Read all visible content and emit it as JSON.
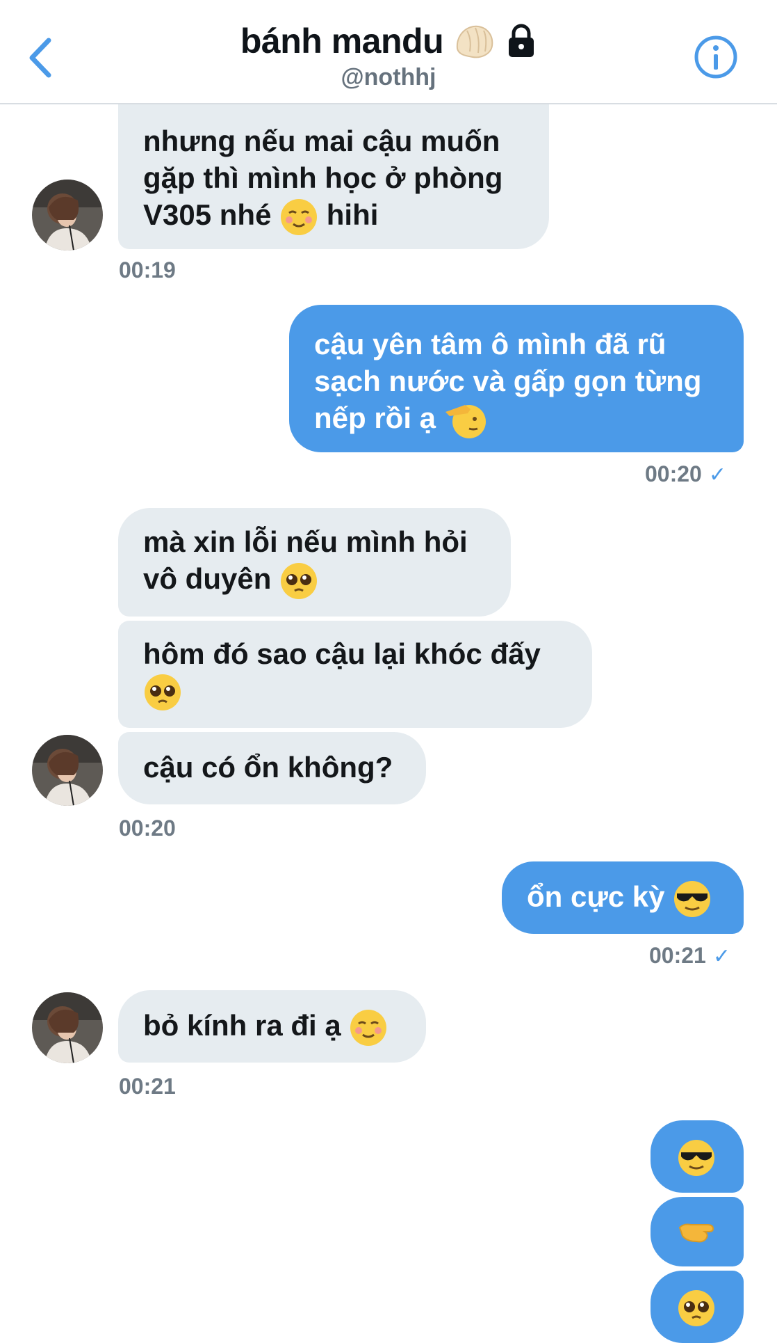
{
  "header": {
    "title": "bánh mandu",
    "handle": "@nothhj"
  },
  "messages": [
    {
      "text": "nhưng nếu mai cậu muốn gặp thì mình học ở phòng V305 nhé",
      "tail": "hihi"
    },
    {
      "text": "cậu yên tâm ô mình đã rũ sạch nước và gấp gọn từng nếp rồi ạ"
    },
    {
      "text": "mà xin lỗi nếu mình hỏi vô duyên"
    },
    {
      "text": "hôm đó sao cậu lại khóc đấy"
    },
    {
      "text": "cậu có ổn không?"
    },
    {
      "text": "ổn cực kỳ"
    },
    {
      "text": "bỏ kính ra đi ạ"
    }
  ],
  "times": [
    "00:19",
    "00:20",
    "00:20",
    "00:21",
    "00:21"
  ],
  "colors": {
    "outgoing": "#4b9ae8",
    "incoming": "#e6ecf0"
  },
  "icons": [
    "back-chevron-icon",
    "dumpling-emoji",
    "lock-icon",
    "info-icon",
    "blush-emoji",
    "saluting-face-emoji",
    "pleading-face-emoji",
    "sunglasses-emoji",
    "pointing-hand-emoji"
  ]
}
